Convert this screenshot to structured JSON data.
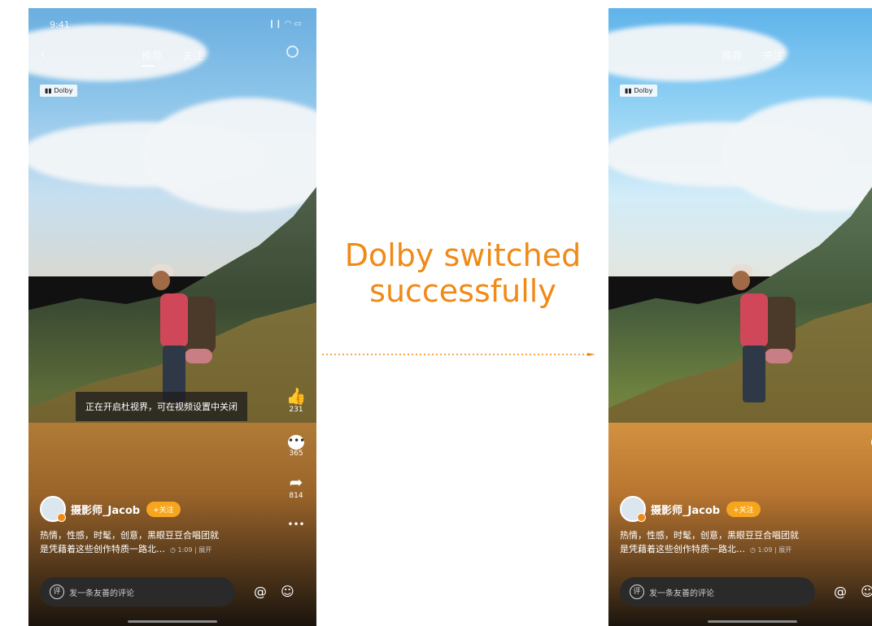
{
  "status": {
    "time": "9:41",
    "icons": "❙❙ ◠ ▭"
  },
  "top_nav": {
    "back_glyph": "‹",
    "tabs": [
      "推荐",
      "关注"
    ]
  },
  "dolby_badge": "▮▮ Dolby",
  "toast": "正在开启杜视界，可在视频设置中关闭",
  "actions": {
    "like_glyph": "👍",
    "like_count": "231",
    "comment_glyph": "•••",
    "comment_count": "365",
    "share_glyph": "➦",
    "share_count": "814",
    "more_glyph": "•••"
  },
  "user": {
    "name": "摄影师_Jacob",
    "follow_label": "+关注"
  },
  "caption": {
    "line1": "热情，性感，时髦，创意，黑眼豆豆合唱团就",
    "line2": "是凭藉着这些创作特质一路北…",
    "meta": "◷ 1:09 | 展开"
  },
  "comment_bar": {
    "icon_text": "评",
    "placeholder": "发一条友善的评论",
    "at_glyph": "@",
    "emoji_glyph": "☺"
  },
  "annotation": {
    "text_line1": "Dolby switched",
    "text_line2": "successfully",
    "color": "#f08a17"
  }
}
